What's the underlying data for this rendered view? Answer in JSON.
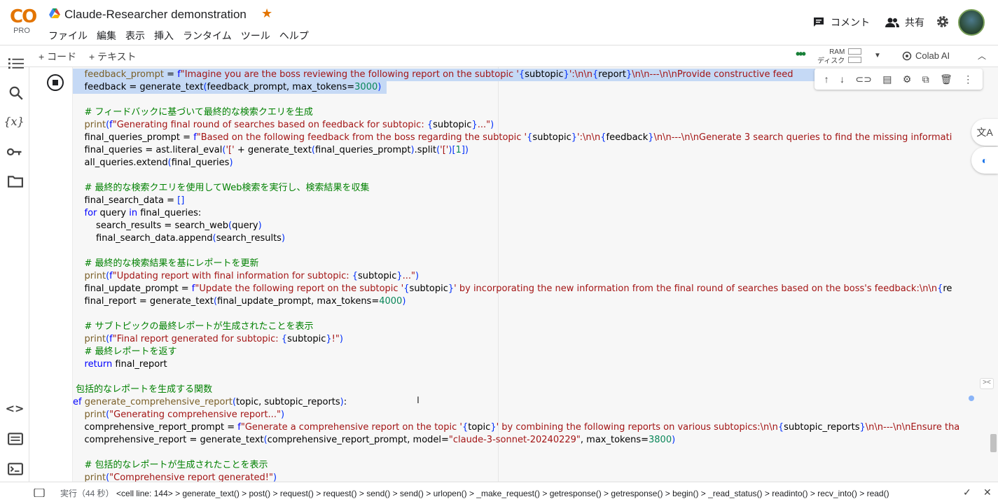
{
  "app": {
    "title": "Claude-Researcher demonstration",
    "logo_text": "CO",
    "plan": "PRO"
  },
  "menu": [
    "ファイル",
    "編集",
    "表示",
    "挿入",
    "ランタイム",
    "ツール",
    "ヘルプ"
  ],
  "header_actions": {
    "comment_label": "コメント",
    "share_label": "共有"
  },
  "toolbar": {
    "add_code": "+ コード",
    "add_text": "+ テキスト",
    "ram_label": "RAM",
    "disk_label": "ディスク",
    "colab_ai_label": "Colab AI"
  },
  "icons": {
    "rail": [
      "toc-icon",
      "search-icon",
      "variables-icon",
      "key-icon",
      "folder-icon",
      "code-snippets-icon",
      "command-palette-icon",
      "terminal-icon"
    ],
    "cell_toolbar": [
      "arrow-up-icon",
      "arrow-down-icon",
      "link-icon",
      "comment-icon",
      "gear-icon",
      "mirror-cell-icon",
      "delete-icon",
      "more-icon"
    ]
  },
  "code_lines": [
    "    feedback_prompt = f\"Imagine you are the boss reviewing the following report on the subtopic '{subtopic}':\\n\\n{report}\\n\\n---\\n\\nProvide constructive feed",
    "    feedback = generate_text(feedback_prompt, max_tokens=3000)",
    "",
    "    # フィードバックに基づいて最終的な検索クエリを生成",
    "    print(f\"Generating final round of searches based on feedback for subtopic: {subtopic}...\")",
    "    final_queries_prompt = f\"Based on the following feedback from the boss regarding the subtopic '{subtopic}':\\n\\n{feedback}\\n\\n---\\n\\nGenerate 3 search queries to find the missing informati",
    "    final_queries = ast.literal_eval('[' + generate_text(final_queries_prompt).split('[')[1])",
    "    all_queries.extend(final_queries)",
    "",
    "    # 最終的な検索クエリを使用してWeb検索を実行し、検索結果を収集",
    "    final_search_data = []",
    "    for query in final_queries:",
    "        search_results = search_web(query)",
    "        final_search_data.append(search_results)",
    "",
    "    # 最終的な検索結果を基にレポートを更新",
    "    print(f\"Updating report with final information for subtopic: {subtopic}...\")",
    "    final_update_prompt = f\"Update the following report on the subtopic '{subtopic}' by incorporating the new information from the final round of searches based on the boss's feedback:\\n\\n{re",
    "    final_report = generate_text(final_update_prompt, max_tokens=4000)",
    "",
    "    # サブトピックの最終レポートが生成されたことを表示",
    "    print(f\"Final report generated for subtopic: {subtopic}!\")",
    "    # 最終レポートを返す",
    "    return final_report",
    "",
    " 包括的なレポートを生成する関数",
    "ef generate_comprehensive_report(topic, subtopic_reports):",
    "    print(\"Generating comprehensive report...\")",
    "    comprehensive_report_prompt = f\"Generate a comprehensive report on the topic '{topic}' by combining the following reports on various subtopics:\\n\\n{subtopic_reports}\\n\\n---\\n\\nEnsure tha",
    "    comprehensive_report = generate_text(comprehensive_report_prompt, model=\"claude-3-sonnet-20240229\", max_tokens=3800)",
    "",
    "    # 包括的なレポートが生成されたことを表示",
    "    print(\"Comprehensive report generated!\")"
  ],
  "status": {
    "running": "実行（44 秒）",
    "trace": "<cell line: 144> > generate_text() > post() > request() > request() > send() > send() > urlopen() > _make_request() > getresponse() > getresponse() > begin() > _read_status() > readinto() > recv_into() > read()"
  },
  "colors": {
    "accent": "#1a73e8",
    "selection": "#c5d9f5",
    "keyword": "#0000ff",
    "string": "#a31515",
    "comment": "#008000",
    "number": "#098658"
  }
}
